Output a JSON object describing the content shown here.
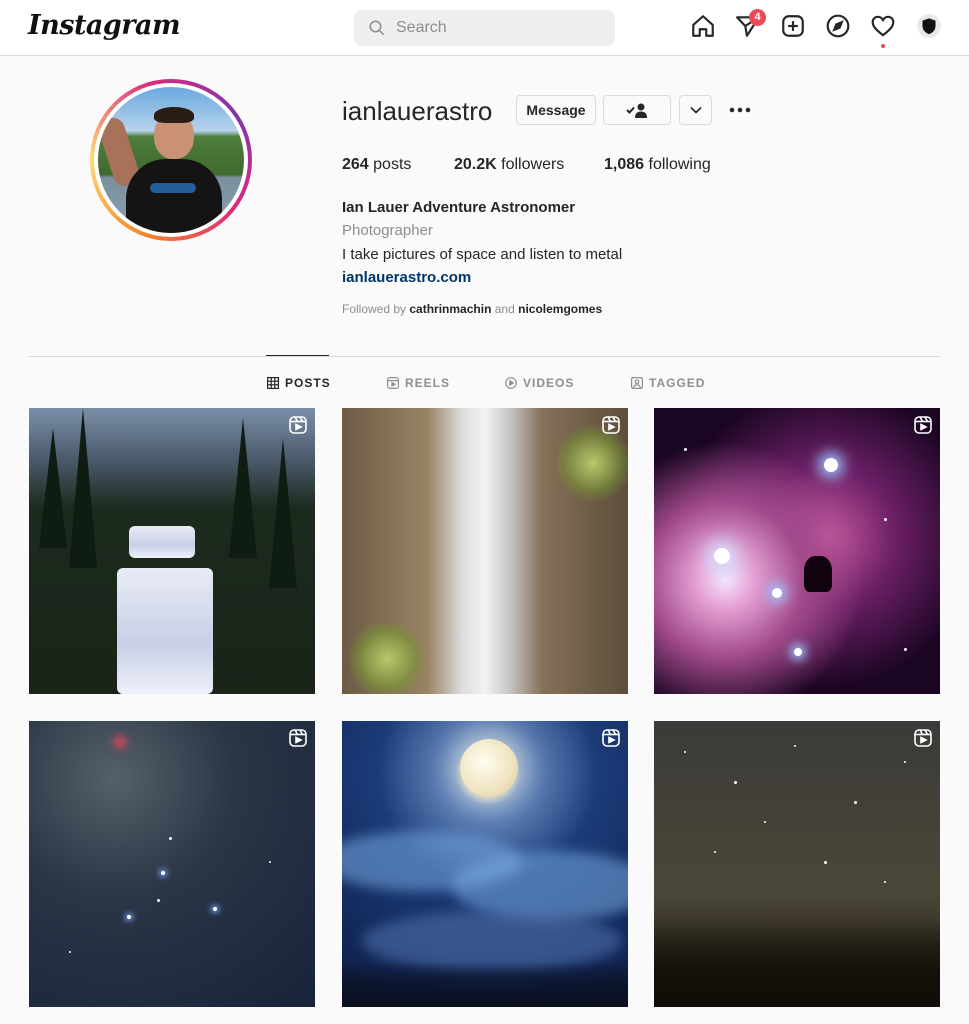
{
  "app": {
    "logo": "Instagram"
  },
  "search": {
    "placeholder": "Search"
  },
  "nav": {
    "icons": [
      "home-icon",
      "direct-messages-icon",
      "new-post-icon",
      "explore-icon",
      "activity-heart-icon",
      "profile-avatar-icon"
    ],
    "messages_badge": "4"
  },
  "profile": {
    "username": "ianlauerastro",
    "buttons": {
      "message": "Message"
    },
    "stats": {
      "posts_count": "264",
      "posts_label": "posts",
      "followers_count": "20.2K",
      "followers_label": "followers",
      "following_count": "1,086",
      "following_label": "following"
    },
    "full_name": "Ian Lauer Adventure Astronomer",
    "category": "Photographer",
    "bio": "I take pictures of space and listen to metal",
    "website": "ianlauerastro.com",
    "followed_by": {
      "prefix": "Followed by",
      "user1": "cathrinmachin",
      "conj": "and",
      "user2": "nicolemgomes"
    }
  },
  "tabs": [
    {
      "label": "POSTS",
      "icon": "grid-icon",
      "active": true
    },
    {
      "label": "REELS",
      "icon": "reels-icon",
      "active": false
    },
    {
      "label": "VIDEOS",
      "icon": "play-icon",
      "active": false
    },
    {
      "label": "TAGGED",
      "icon": "tag-icon",
      "active": false
    }
  ],
  "posts": [
    {
      "subject": "waterfall in forest",
      "type": "reel"
    },
    {
      "subject": "waterfall between cliffs",
      "type": "reel"
    },
    {
      "subject": "pink nebula",
      "type": "reel"
    },
    {
      "subject": "starry sky",
      "type": "reel"
    },
    {
      "subject": "full moon over clouds",
      "type": "reel"
    },
    {
      "subject": "stars over bare trees",
      "type": "reel"
    }
  ],
  "colors": {
    "accent_link": "#00376b",
    "badge": "#ed4956",
    "text": "#262626",
    "muted": "#8e8e8e"
  }
}
